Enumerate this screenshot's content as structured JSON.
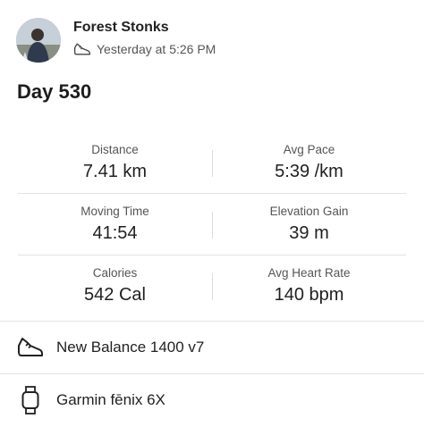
{
  "activity": {
    "athlete_name": "Forest Stonks",
    "timestamp": "Yesterday at 5:26 PM",
    "title": "Day 530"
  },
  "stats": [
    [
      {
        "label": "Distance",
        "value": "7.41 km"
      },
      {
        "label": "Avg Pace",
        "value": "5:39 /km"
      }
    ],
    [
      {
        "label": "Moving Time",
        "value": "41:54"
      },
      {
        "label": "Elevation Gain",
        "value": "39 m"
      }
    ],
    [
      {
        "label": "Calories",
        "value": "542 Cal"
      },
      {
        "label": "Avg Heart Rate",
        "value": "140 bpm"
      }
    ]
  ],
  "gear": {
    "shoes": {
      "icon": "shoe-icon",
      "label": "New Balance 1400 v7"
    },
    "device": {
      "icon": "watch-icon",
      "label": "Garmin fēnix 6X"
    }
  }
}
